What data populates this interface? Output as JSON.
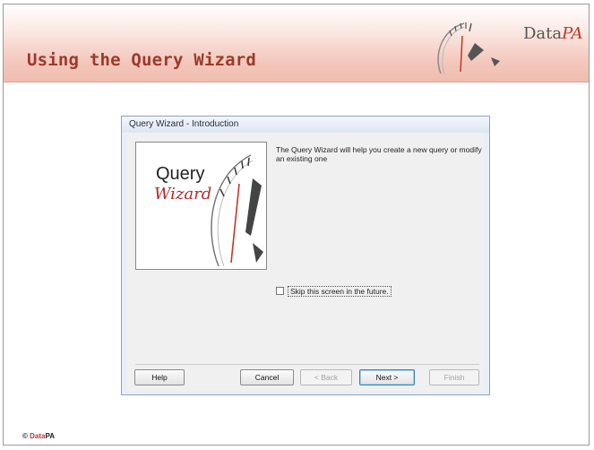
{
  "slide": {
    "title": "Using the Query Wizard",
    "brand": {
      "part1": "Data",
      "part2": "PA"
    },
    "footer": {
      "symbol": "©",
      "part1": "Data",
      "part2": "PA"
    }
  },
  "dialog": {
    "title": "Query Wizard - Introduction",
    "image": {
      "word1": "Query",
      "word2": "Wizard"
    },
    "intro_text": "The Query Wizard will help you create a new query or modify an existing one",
    "skip_checkbox": {
      "label": "Skip this screen in the future.",
      "checked": false
    },
    "buttons": {
      "help": "Help",
      "cancel": "Cancel",
      "back": "< Back",
      "next": "Next >",
      "finish": "Finish"
    }
  },
  "colors": {
    "title": "#9b3b2b",
    "brand_accent": "#c0392b",
    "header_band": "#f3c7bc",
    "dialog_frame": "#eaeff7"
  }
}
